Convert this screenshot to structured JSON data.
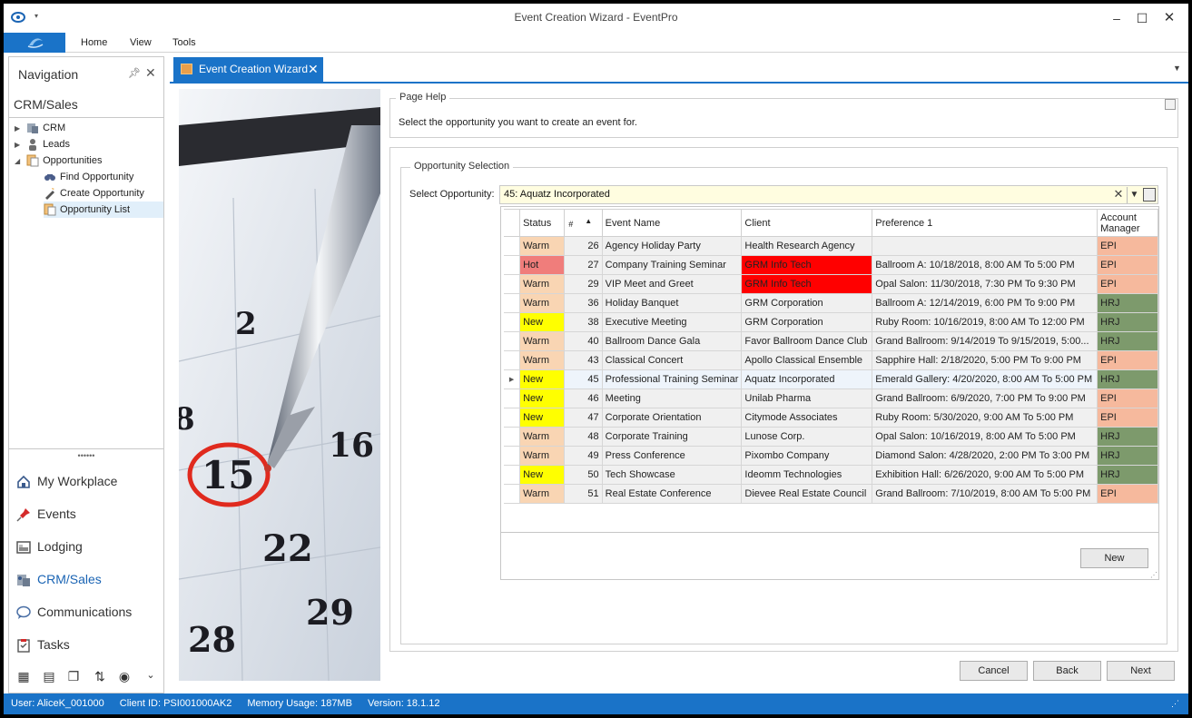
{
  "window": {
    "title": "Event Creation Wizard - EventPro"
  },
  "ribbon": {
    "tabs": [
      "Home",
      "View",
      "Tools"
    ]
  },
  "nav": {
    "header": "Navigation",
    "section": "CRM/Sales",
    "tree": [
      {
        "label": "CRM",
        "icon": "crm-icon"
      },
      {
        "label": "Leads",
        "icon": "person-icon"
      },
      {
        "label": "Opportunities",
        "icon": "opportunities-icon"
      },
      {
        "label": "Find Opportunity",
        "icon": "binoculars-icon"
      },
      {
        "label": "Create Opportunity",
        "icon": "create-icon"
      },
      {
        "label": "Opportunity List",
        "icon": "list-icon"
      }
    ],
    "buttons": [
      {
        "label": "My Workplace",
        "icon": "house-icon"
      },
      {
        "label": "Events",
        "icon": "pin-icon"
      },
      {
        "label": "Lodging",
        "icon": "lodging-icon"
      },
      {
        "label": "CRM/Sales",
        "icon": "crm-sales-icon"
      },
      {
        "label": "Communications",
        "icon": "speech-bubble-icon"
      },
      {
        "label": "Tasks",
        "icon": "clipboard-icon"
      }
    ]
  },
  "doc_tab": {
    "label": "Event Creation Wizard"
  },
  "page_help": {
    "legend": "Page Help",
    "text": "Select the opportunity you want to create an event for."
  },
  "selection": {
    "legend": "Opportunity Selection",
    "label": "Select Opportunity:",
    "value": "45: Aquatz Incorporated"
  },
  "grid": {
    "columns": [
      "Status",
      "#",
      "Event Name",
      "Client",
      "Preference 1",
      "Account Manager"
    ],
    "rows": [
      {
        "status": "Warm",
        "num": "26",
        "event": "Agency Holiday Party",
        "client": "Health Research Agency",
        "pref": "",
        "mgr": "EPI"
      },
      {
        "status": "Hot",
        "num": "27",
        "event": "Company Training Seminar",
        "client": "GRM Info Tech",
        "pref": "Ballroom A: 10/18/2018, 8:00 AM To 5:00 PM",
        "mgr": "EPI"
      },
      {
        "status": "Warm",
        "num": "29",
        "event": "VIP Meet and Greet",
        "client": "GRM Info Tech",
        "pref": "Opal Salon: 11/30/2018, 7:30 PM To 9:30 PM",
        "mgr": "EPI"
      },
      {
        "status": "Warm",
        "num": "36",
        "event": "Holiday Banquet",
        "client": "GRM Corporation",
        "pref": "Ballroom A: 12/14/2019, 6:00 PM To 9:00 PM",
        "mgr": "HRJ"
      },
      {
        "status": "New",
        "num": "38",
        "event": "Executive Meeting",
        "client": "GRM Corporation",
        "pref": "Ruby Room: 10/16/2019, 8:00 AM To 12:00 PM",
        "mgr": "HRJ"
      },
      {
        "status": "Warm",
        "num": "40",
        "event": "Ballroom Dance Gala",
        "client": "Favor Ballroom Dance Club",
        "pref": "Grand Ballroom: 9/14/2019 To 9/15/2019, 5:00...",
        "mgr": "HRJ"
      },
      {
        "status": "Warm",
        "num": "43",
        "event": "Classical Concert",
        "client": "Apollo Classical Ensemble",
        "pref": "Sapphire Hall: 2/18/2020, 5:00 PM To 9:00 PM",
        "mgr": "EPI"
      },
      {
        "status": "New",
        "num": "45",
        "event": "Professional Training Seminar",
        "client": "Aquatz Incorporated",
        "pref": "Emerald Gallery: 4/20/2020, 8:00 AM To 5:00 PM",
        "mgr": "HRJ"
      },
      {
        "status": "New",
        "num": "46",
        "event": "Meeting",
        "client": "Unilab Pharma",
        "pref": "Grand Ballroom: 6/9/2020, 7:00 PM To 9:00 PM",
        "mgr": "EPI"
      },
      {
        "status": "New",
        "num": "47",
        "event": "Corporate Orientation",
        "client": "Citymode Associates",
        "pref": "Ruby Room: 5/30/2020, 9:00 AM To 5:00 PM",
        "mgr": "EPI"
      },
      {
        "status": "Warm",
        "num": "48",
        "event": "Corporate Training",
        "client": "Lunose Corp.",
        "pref": "Opal Salon: 10/16/2019, 8:00 AM To 5:00 PM",
        "mgr": "HRJ"
      },
      {
        "status": "Warm",
        "num": "49",
        "event": "Press Conference",
        "client": "Pixombo Company",
        "pref": "Diamond Salon: 4/28/2020, 2:00 PM To 3:00 PM",
        "mgr": "HRJ"
      },
      {
        "status": "New",
        "num": "50",
        "event": "Tech Showcase",
        "client": "Ideomm Technologies",
        "pref": "Exhibition Hall: 6/26/2020, 9:00 AM To 5:00 PM",
        "mgr": "HRJ"
      },
      {
        "status": "Warm",
        "num": "51",
        "event": "Real Estate Conference",
        "client": "Dievee Real Estate Council",
        "pref": "Grand Ballroom: 7/10/2019, 8:00 AM To 5:00 PM",
        "mgr": "EPI"
      }
    ],
    "new_button": "New"
  },
  "colors": {
    "Warm": "#f9d5b3",
    "Hot": "#f07d7b",
    "New": "#ffff00",
    "client_red": "#ff0000",
    "EPI": "#f6b99d",
    "HRJ": "#7d9a6c",
    "accent": "#1a73c8"
  },
  "footer": {
    "cancel": "Cancel",
    "back": "Back",
    "next": "Next"
  },
  "status_bar": {
    "user": "User: AliceK_001000",
    "client_id": "Client ID: PSI001000AK2",
    "memory": "Memory Usage: 187MB",
    "version": "Version: 18.1.12"
  }
}
